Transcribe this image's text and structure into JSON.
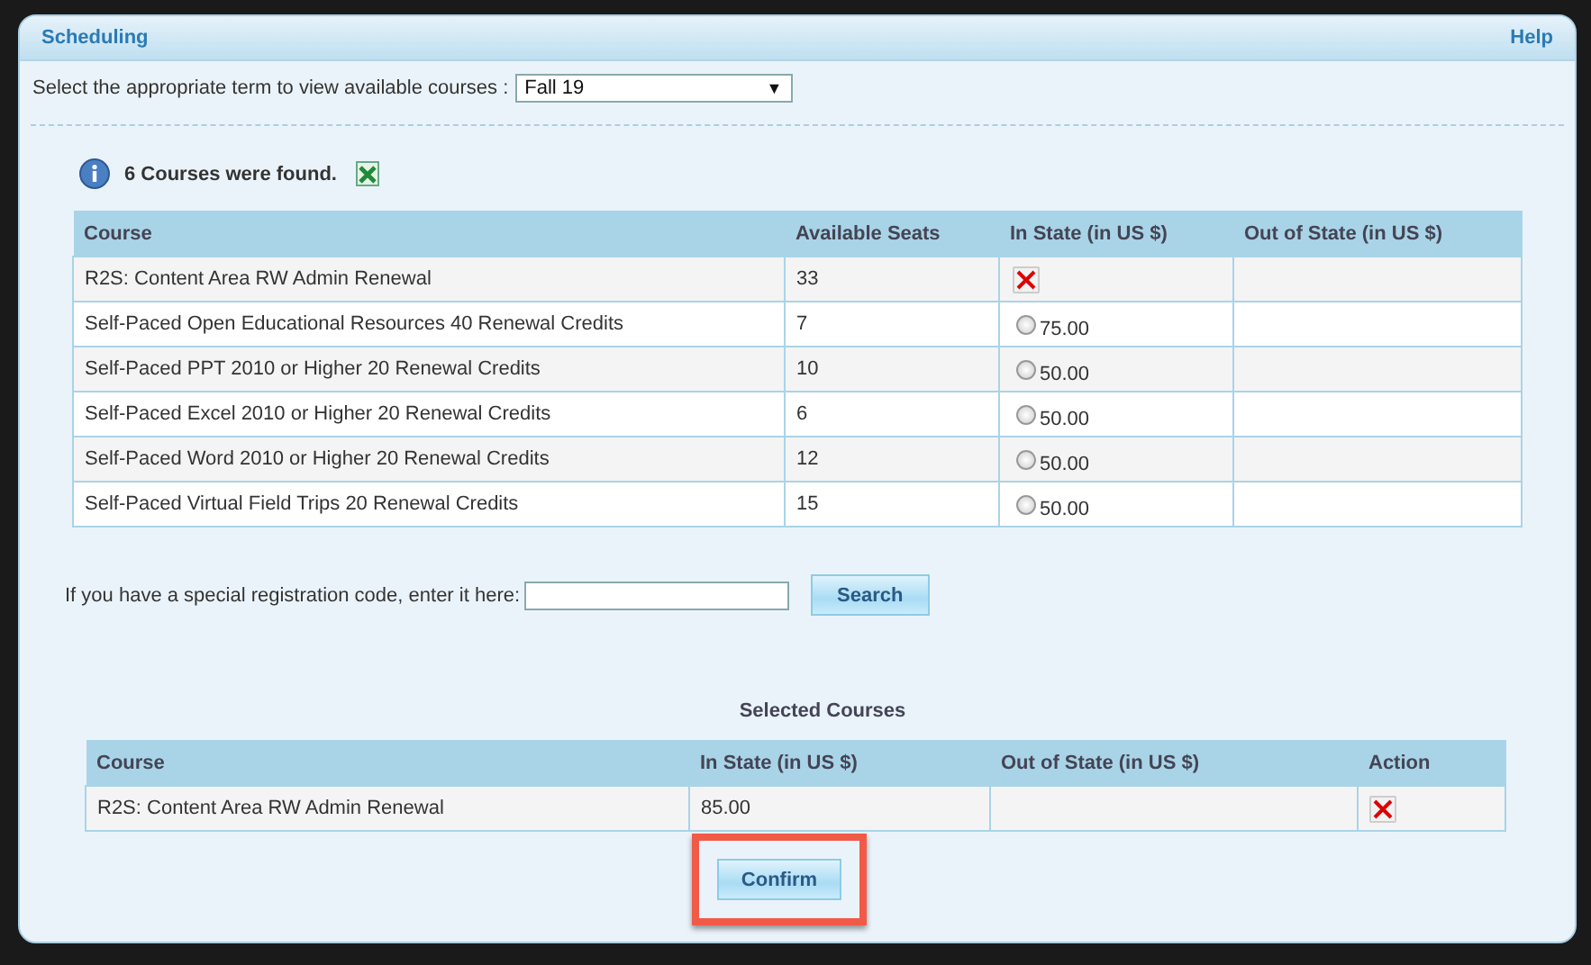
{
  "panel": {
    "title": "Scheduling",
    "help": "Help"
  },
  "term": {
    "label": "Select the appropriate term to view available courses :",
    "value": "Fall 19",
    "arrow": "▼"
  },
  "found": {
    "text": "6 Courses were found."
  },
  "courses": {
    "columns": [
      "Course",
      "Available Seats",
      "In State (in US $)",
      "Out of State (in US $)"
    ],
    "rows": [
      {
        "course": "R2S: Content Area RW Admin Renewal",
        "seats": "33",
        "in_state": {
          "kind": "remove"
        }
      },
      {
        "course": "Self-Paced Open Educational Resources 40 Renewal Credits",
        "seats": "7",
        "in_state": {
          "kind": "radio",
          "selected": false,
          "price": "75.00"
        }
      },
      {
        "course": "Self-Paced PPT 2010 or Higher 20 Renewal Credits",
        "seats": "10",
        "in_state": {
          "kind": "radio",
          "selected": false,
          "price": "50.00"
        }
      },
      {
        "course": "Self-Paced Excel 2010 or Higher 20 Renewal Credits",
        "seats": "6",
        "in_state": {
          "kind": "radio",
          "selected": false,
          "price": "50.00"
        }
      },
      {
        "course": "Self-Paced Word 2010 or Higher 20 Renewal Credits",
        "seats": "12",
        "in_state": {
          "kind": "radio",
          "selected": false,
          "price": "50.00"
        }
      },
      {
        "course": "Self-Paced Virtual Field Trips 20 Renewal Credits",
        "seats": "15",
        "in_state": {
          "kind": "radio",
          "selected": false,
          "price": "50.00"
        }
      }
    ]
  },
  "code": {
    "label": "If you have a special registration code, enter it here:",
    "button": "Search"
  },
  "selected": {
    "title": "Selected Courses",
    "columns": [
      "Course",
      "In State (in US $)",
      "Out of State (in US $)",
      "Action"
    ],
    "rows": [
      {
        "course": "R2S: Content Area RW Admin Renewal",
        "in_state": "85.00"
      }
    ]
  },
  "confirm": {
    "label": "Confirm",
    "highlighted": true
  }
}
